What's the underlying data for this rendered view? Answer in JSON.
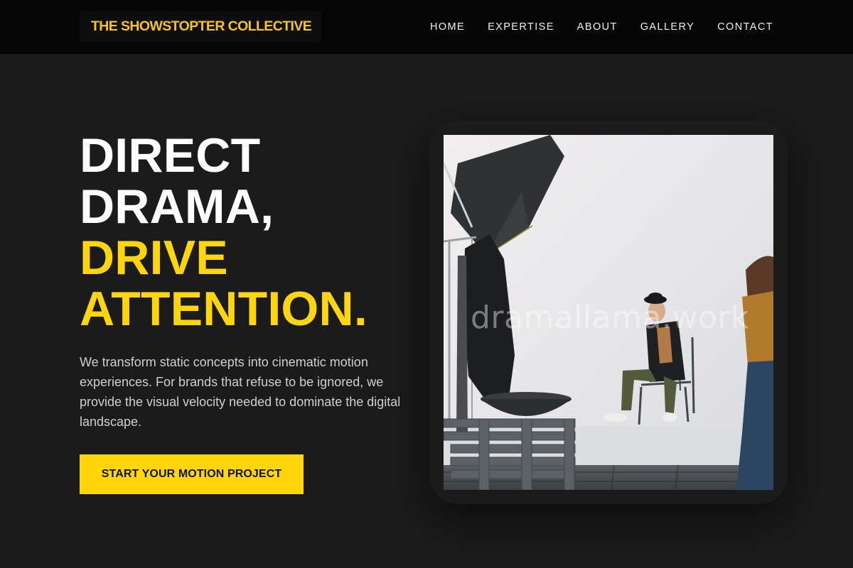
{
  "header": {
    "logo_text": "THE SHOWSTOPTER COLLECTIVE",
    "nav": [
      {
        "label": "HOME"
      },
      {
        "label": "EXPERTISE"
      },
      {
        "label": "ABOUT"
      },
      {
        "label": "GALLERY"
      },
      {
        "label": "CONTACT"
      }
    ]
  },
  "hero": {
    "headline_lines_white": [
      "DIRECT",
      "DRAMA,"
    ],
    "headline_lines_yellow": [
      "DRIVE",
      "ATTENTION."
    ],
    "description": "We transform static concepts into cinematic motion experiences. For brands that refuse to be ignored, we provide the visual velocity needed to dominate the digital landscape.",
    "cta_label": "START YOUR MOTION PROJECT",
    "image": {
      "watermark": "dramallama.work"
    }
  },
  "colors": {
    "accent": "#ffd60a",
    "background": "#1b1b1b",
    "header_background": "#060606"
  }
}
